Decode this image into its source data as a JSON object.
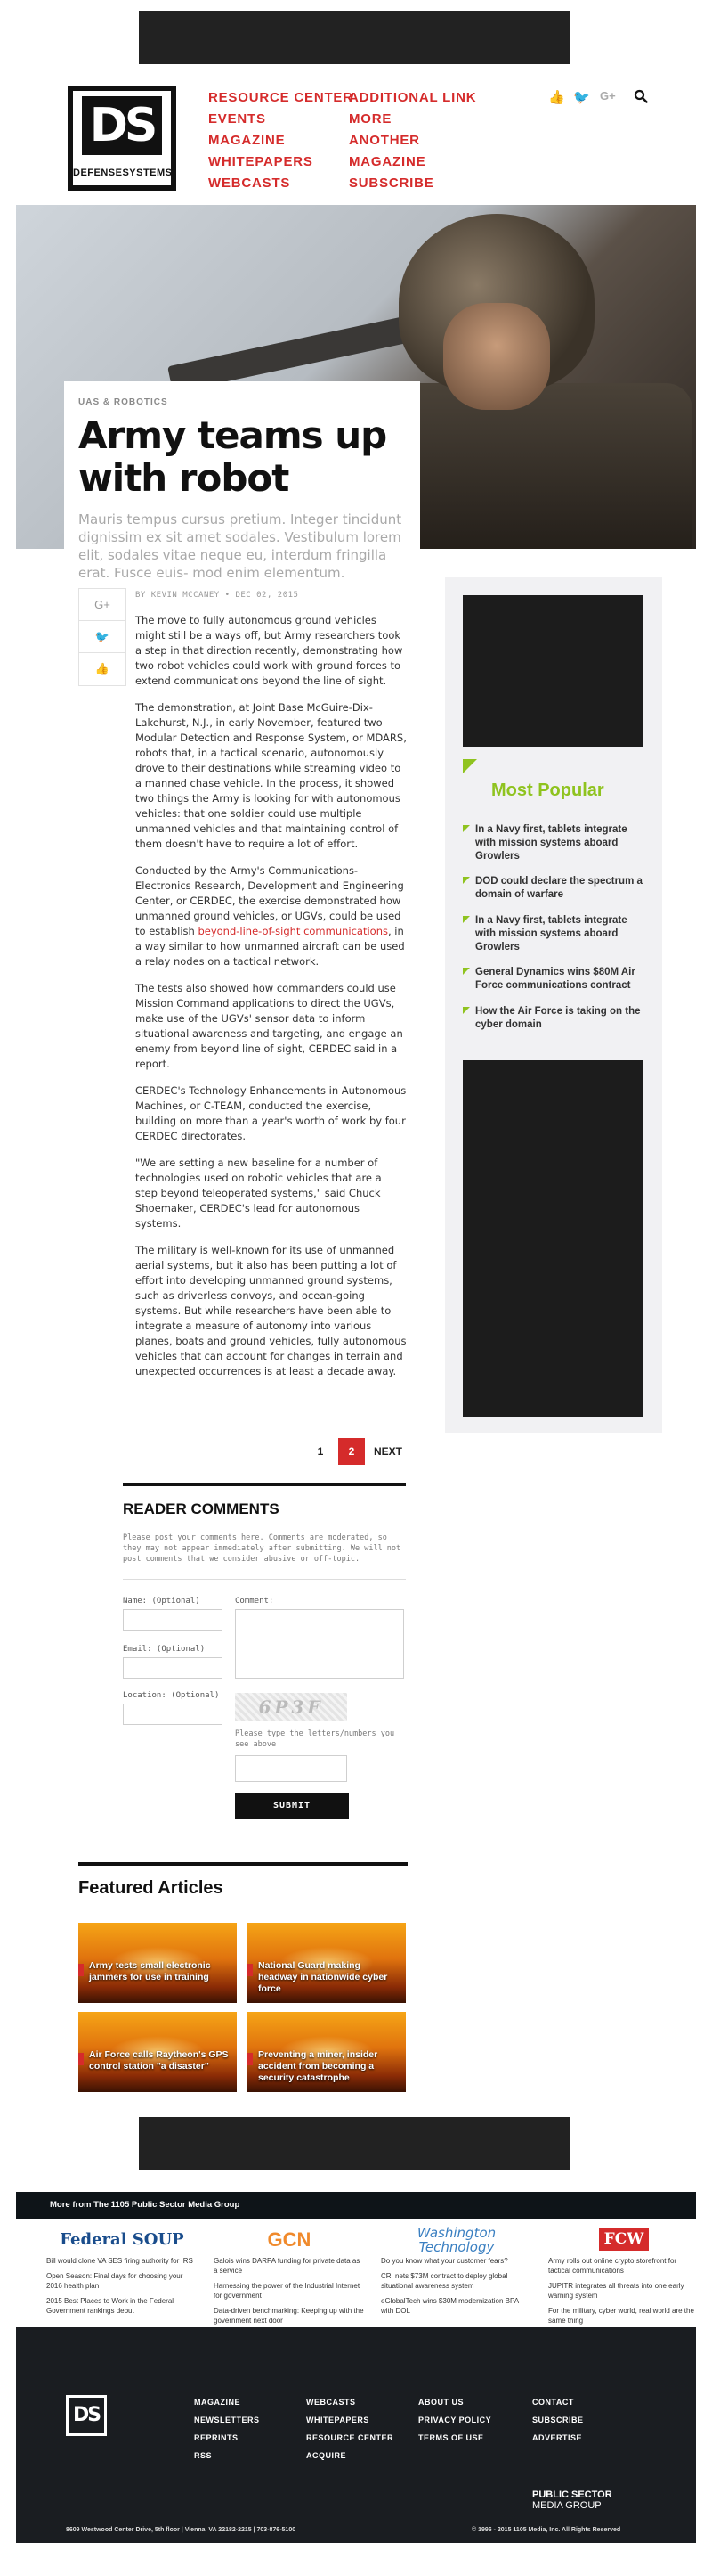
{
  "header": {
    "logo_monogram": "DS",
    "logo_text": "DEFENSESYSTEMS",
    "nav_left": [
      "RESOURCE CENTER",
      "EVENTS",
      "MAGAZINE",
      "WHITEPAPERS",
      "WEBCASTS"
    ],
    "nav_right": [
      "ADDITIONAL LINK",
      "MORE",
      "ANOTHER",
      "MAGAZINE",
      "SUBSCRIBE"
    ]
  },
  "article": {
    "category": "UAS & ROBOTICS",
    "headline": "Army teams up with robot",
    "subhead": "Mauris tempus cursus pretium. Integer tincidunt dignissim ex sit amet sodales. Vestibulum lorem elit, sodales vitae neque eu, interdum fringilla erat. Fusce euis- mod enim elementum.",
    "byline": "BY KEVIN MCCANEY  •  DEC 02, 2015",
    "paragraphs": [
      "The move to fully autonomous ground vehicles might still be a ways off, but Army researchers took a step in that direction recently, demonstrating how two robot vehicles could work with ground forces to extend communications beyond the line of sight.",
      "The demonstration, at Joint Base McGuire-Dix-Lakehurst, N.J., in early November, featured two Modular Detection and Response System, or MDARS, robots that, in a tactical scenario, autonomously drove to their destinations while streaming video to a manned chase vehicle. In the process, it showed two things the Army is looking for with autonomous vehicles: that one soldier could use multiple unmanned vehicles and that maintaining control of them doesn't have to require a lot of effort.",
      "Conducted by the Army's Communications-Electronics Research, Development and Engineering Center, or CERDEC, the exercise demonstrated how unmanned ground vehicles, or UGVs, could be used to establish ",
      "The tests also showed how commanders could use Mission Command applications to direct the UGVs, make use of the UGVs' sensor data to inform situational awareness and targeting, and engage an enemy from beyond line of sight, CERDEC said in a report.",
      "CERDEC's Technology Enhancements in Autonomous Machines, or C-TEAM, conducted the exercise, building on more than a year's worth of work by four CERDEC directorates.",
      "\"We are setting a new baseline for a number of technologies used on robotic vehicles that are a step beyond teleoperated systems,\" said Chuck Shoemaker, CERDEC's lead for autonomous systems.",
      "The military is well-known for its use of unmanned aerial systems, but it also has been putting a lot of effort into developing unmanned ground systems, such as driverless convoys, and ocean-going systems. But while researchers have been able to integrate a measure of autonomy into various planes, boats and ground vehicles, fully autonomous vehicles that can account for changes in terrain and unexpected occurrences is at least a decade away."
    ],
    "p3_link": "beyond-line-of-sight communications",
    "p3_tail": ", in a way similar to how unmanned aircraft can be used a relay nodes on a tactical network."
  },
  "share": {
    "icons": [
      "google-plus-icon",
      "twitter-icon",
      "like-icon"
    ],
    "glyphs": [
      "G+",
      "🐦",
      "👍"
    ]
  },
  "sidebar": {
    "popular_title": "Most Popular",
    "popular": [
      "In a Navy first, tablets integrate with mission systems aboard Growlers",
      "DOD could declare the spectrum a domain of warfare",
      "In a Navy first, tablets integrate with mission systems aboard Growlers",
      "General Dynamics wins $80M Air Force communications contract",
      "How the Air Force is taking on the cyber domain"
    ]
  },
  "pager": {
    "pages": [
      "1",
      "2"
    ],
    "active": "2",
    "next": "NEXT"
  },
  "comments": {
    "title": "READER COMMENTS",
    "note": "Please post your comments here. Comments are moderated, so they may not appear immediately after submitting. We will not post comments that we consider abusive or off-topic.",
    "name_label": "Name: (Optional)",
    "email_label": "Email: (Optional)",
    "location_label": "Location: (Optional)",
    "comment_label": "Comment:",
    "captcha_text": "6P3F",
    "captcha_hint": "Please type the letters/numbers you see above",
    "submit": "SUBMIT"
  },
  "featured": {
    "title": "Featured Articles",
    "items": [
      "Army tests small electronic jammers for use in training",
      "National Guard making headway in nationwide cyber force",
      "Air Force calls Raytheon's GPS control station \"a disaster\"",
      "Preventing a miner, insider accident from becoming a security catastrophe"
    ]
  },
  "more_from": {
    "title": "More from The 1105 Public Sector Media Group",
    "pubs": [
      {
        "logo": "Federal SOUP",
        "color": "#1a4d8c",
        "items": [
          "Bill would clone VA SES firing authority for IRS",
          "Open Season: Final days for choosing your 2016 health plan",
          "2015 Best Places to Work in the Federal Government rankings debut"
        ]
      },
      {
        "logo": "GCN",
        "color": "#f08a2c",
        "items": [
          "Galois wins DARPA funding for private data as a service",
          "Harnessing the power of the Industrial Internet for government",
          "Data-driven benchmarking: Keeping up with the government next door"
        ]
      },
      {
        "logo": "Washington Technology",
        "color": "#3a7fc1",
        "items": [
          "Do you know what your customer fears?",
          "CRI nets $73M contract to deploy global situational awareness system",
          "eGlobalTech wins $30M modernization BPA with DOL"
        ]
      },
      {
        "logo": "FCW",
        "color": "#d52b2b",
        "items": [
          "Army rolls out online crypto storefront for tactical communications",
          "JUPITR integrates all threats into one early warning system",
          "For the military, cyber world, real world are the same thing"
        ]
      }
    ]
  },
  "footer": {
    "logo": "DS",
    "col1": [
      "MAGAZINE",
      "NEWSLETTERS",
      "REPRINTS",
      "RSS"
    ],
    "col2": [
      "WEBCASTS",
      "WHITEPAPERS",
      "RESOURCE CENTER",
      "ACQUIRE"
    ],
    "col3": [
      "ABOUT US",
      "PRIVACY POLICY",
      "TERMS OF USE"
    ],
    "col4": [
      "CONTACT",
      "SUBSCRIBE",
      "ADVERTISE"
    ],
    "psmg_line1": "PUBLIC SECTOR",
    "psmg_line2": "MEDIA GROUP",
    "address": "8609 Westwood Center Drive, 5th floor  |  Vienna, VA 22182-2215  |  703-876-5100",
    "copyright": "© 1996 - 2015 1105 Media, Inc. All Rights Reserved"
  }
}
